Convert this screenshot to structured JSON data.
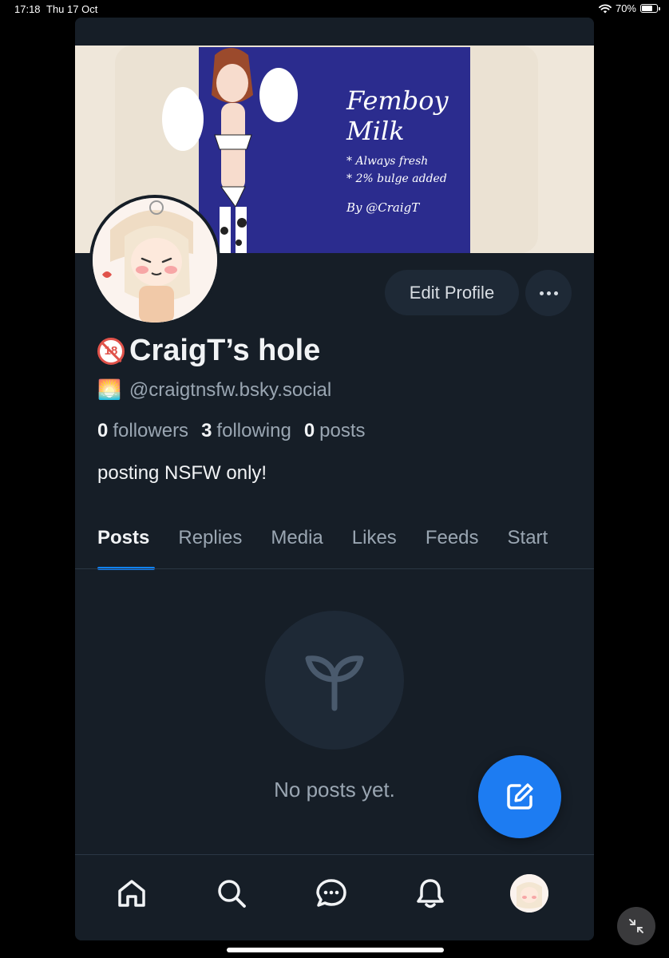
{
  "status_bar": {
    "time": "17:18",
    "date": "Thu 17 Oct",
    "battery": "70%",
    "battery_level": 0.7
  },
  "banner": {
    "line1": "Femboy",
    "line2": "Milk",
    "line3": "* Always fresh",
    "line4": "* 2% bulge added",
    "line5": "By @CraigT"
  },
  "profile": {
    "display_name": "CraigT’s hole",
    "name_badge": "18",
    "handle_emoji": "🌅",
    "handle": "@craigtnsfw.bsky.social",
    "followers_count": "0",
    "followers_label": "followers",
    "following_count": "3",
    "following_label": "following",
    "posts_count": "0",
    "posts_label": "posts",
    "bio": "posting NSFW only!"
  },
  "actions": {
    "edit_profile": "Edit Profile",
    "more_icon": "ellipsis-icon"
  },
  "tabs": [
    {
      "label": "Posts",
      "active": true
    },
    {
      "label": "Replies",
      "active": false
    },
    {
      "label": "Media",
      "active": false
    },
    {
      "label": "Likes",
      "active": false
    },
    {
      "label": "Feeds",
      "active": false
    },
    {
      "label": "Start",
      "active": false
    }
  ],
  "empty_state": {
    "icon": "seedling-icon",
    "text": "No posts yet."
  },
  "fab": {
    "icon": "compose-icon"
  },
  "bottom_nav": [
    {
      "name": "home",
      "icon": "home-icon"
    },
    {
      "name": "search",
      "icon": "search-icon"
    },
    {
      "name": "chat",
      "icon": "chat-icon"
    },
    {
      "name": "notifications",
      "icon": "bell-icon"
    },
    {
      "name": "profile",
      "icon": "avatar"
    }
  ],
  "colors": {
    "background": "#161e27",
    "accent": "#1083fe",
    "fab": "#1d7cf2",
    "muted_text": "#9aa6b2",
    "pill": "#1e2936"
  }
}
